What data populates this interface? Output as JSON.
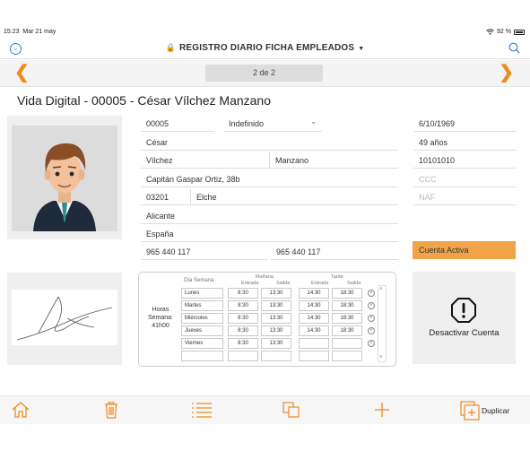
{
  "status_bar": {
    "time": "15:23",
    "date": "Mar 21 may",
    "battery": "92 %"
  },
  "nav": {
    "title": "REGISTRO DIARIO FICHA EMPLEADOS"
  },
  "pager": {
    "indicator": "2 de 2"
  },
  "record": {
    "title": "Vida Digital - 00005 - César Vílchez Manzano"
  },
  "form": {
    "code": "00005",
    "contract": "Indefinido",
    "first_name": "César",
    "last_name_1": "Vílchez",
    "last_name_2": "Manzano",
    "address": "Capitán Gaspar Ortiz, 38b",
    "postal_code": "03201",
    "city": "Elche",
    "province": "Alicante",
    "country": "España",
    "phone_1": "965 440 117",
    "phone_2": "965 440 117",
    "birth_date": "6/10/1969",
    "age": "49 años",
    "id_number": "10101010",
    "ccc_placeholder": "CCC",
    "naf_placeholder": "NAF",
    "status": "Cuenta Activa"
  },
  "schedule": {
    "day_header": "Día Semana",
    "morning_header": "Mañana",
    "afternoon_header": "Tarde",
    "entry_header": "Entrada",
    "exit_header": "Salida",
    "hours_label_1": "Horas",
    "hours_label_2": "Semana:",
    "hours_value": "41h00",
    "rows": [
      {
        "day": "Lunes",
        "m_in": "8:30",
        "m_out": "13:30",
        "a_in": "14:30",
        "a_out": "18:30"
      },
      {
        "day": "Martes",
        "m_in": "8:30",
        "m_out": "13:30",
        "a_in": "14:30",
        "a_out": "18:30"
      },
      {
        "day": "Miércoles",
        "m_in": "8:30",
        "m_out": "13:30",
        "a_in": "14:30",
        "a_out": "18:30"
      },
      {
        "day": "Jueves",
        "m_in": "8:30",
        "m_out": "13:30",
        "a_in": "14:30",
        "a_out": "18:30"
      },
      {
        "day": "Viernes",
        "m_in": "8:30",
        "m_out": "13:30",
        "a_in": "",
        "a_out": ""
      },
      {
        "day": "",
        "m_in": "",
        "m_out": "",
        "a_in": "",
        "a_out": ""
      }
    ]
  },
  "actions": {
    "deactivate": "Desactivar Cuenta",
    "duplicate": "Duplicar"
  },
  "icons": {
    "status": [
      "wifi-icon",
      "battery-icon"
    ],
    "nav": [
      "chevron-circle-icon",
      "lock-icon",
      "caret-down-icon",
      "search-icon"
    ],
    "pager": [
      "chevron-left-icon",
      "chevron-right-icon"
    ],
    "toolbar": [
      "home-icon",
      "trash-icon",
      "list-icon",
      "copy-icon",
      "plus-icon",
      "duplicate-icon"
    ],
    "alert": "warning-octagon-icon"
  },
  "colors": {
    "accent": "#ef8a1f",
    "status_active": "#f1a347",
    "link_blue": "#3b7ad8"
  }
}
